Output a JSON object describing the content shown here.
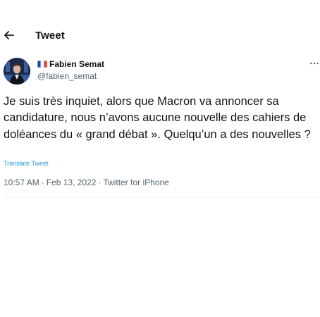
{
  "header": {
    "back_icon": "arrow-left-icon",
    "title": "Tweet"
  },
  "author": {
    "flag_icon": "france-flag-icon",
    "display_name": "Fabien Semat",
    "handle": "@fabien_semat",
    "more_icon": "more-horizontal-icon"
  },
  "tweet": {
    "text": "Je suis très inquiet, alors que Macron va annoncer sa candidature, nous n’avons aucune nouvelle des cahiers de doléances du « grand débat ». Quelqu’un a des nouvelles ?",
    "translate_label": "Translate Tweet",
    "time": "10:57 AM",
    "separator": "·",
    "date": "Feb 13, 2022",
    "client": "Twitter for iPhone"
  },
  "colors": {
    "text": "#0f1419",
    "secondary": "#536471",
    "link": "#1d9bf0",
    "divider": "#eff3f4"
  }
}
